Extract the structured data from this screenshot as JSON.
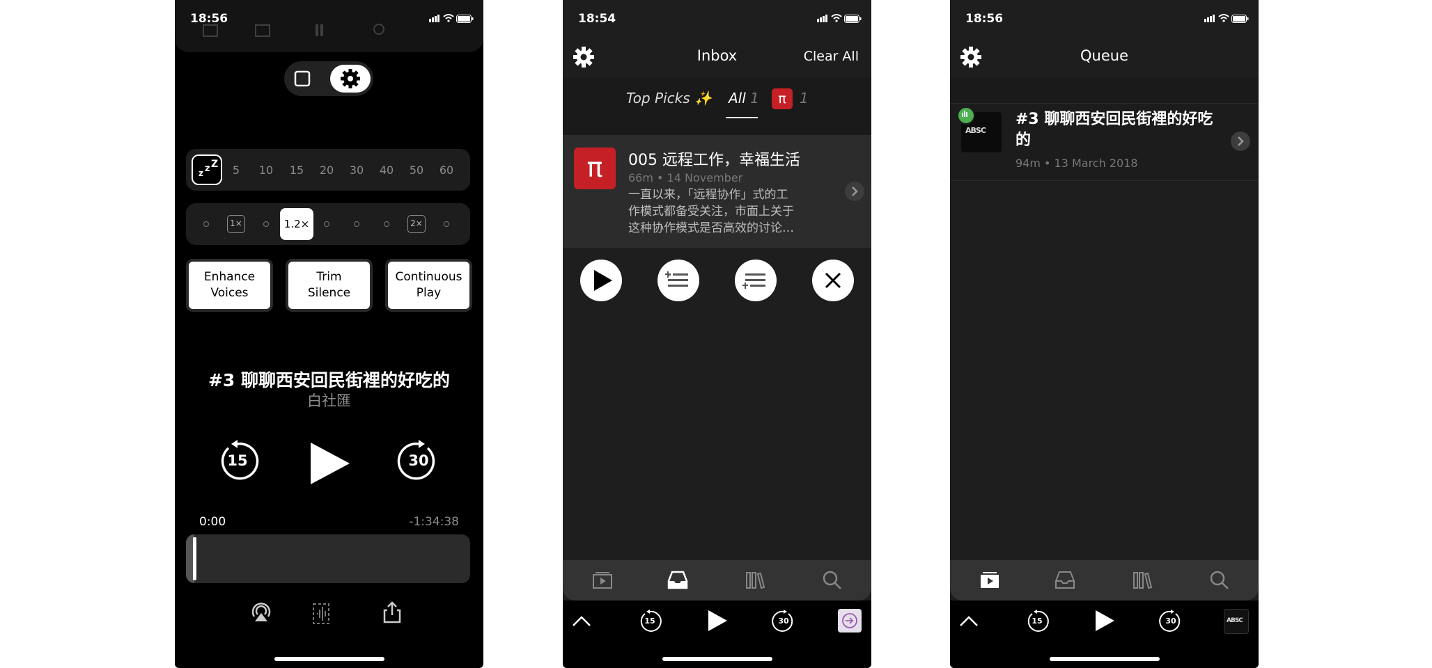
{
  "phone1": {
    "status": {
      "time": "18:56"
    },
    "sleep_timer": {
      "options": [
        "5",
        "10",
        "15",
        "20",
        "30",
        "40",
        "50",
        "60"
      ]
    },
    "speed": {
      "marks": [
        "1×",
        "1.2×",
        "2×"
      ],
      "selected": "1.2×"
    },
    "toggles": [
      {
        "line1": "Enhance",
        "line2": "Voices"
      },
      {
        "line1": "Trim",
        "line2": "Silence"
      },
      {
        "line1": "Continuous",
        "line2": "Play"
      }
    ],
    "episode": {
      "title": "#3 聊聊西安回民街裡的好吃的",
      "artist": "白社匯"
    },
    "skip_back": "15",
    "skip_forward": "30",
    "time_elapsed": "0:00",
    "time_remaining": "-1:34:38",
    "progress": 0
  },
  "phone2": {
    "status": {
      "time": "18:54"
    },
    "header": {
      "title": "Inbox",
      "right": "Clear All"
    },
    "tabs": {
      "top_picks": "Top Picks ✨",
      "all": "All",
      "all_count": "1",
      "pi_icon": "π",
      "pi_count": "1"
    },
    "episode": {
      "art": "π",
      "title": "005 远程工作，幸福生活",
      "meta": "66m • 14 November",
      "desc_lines": [
        "一直以来，「远程协作」式的工",
        "作模式都备受关注，市面上关于",
        "这种协作模式是否高效的讨论…"
      ]
    },
    "mini_player": {
      "skip_back": "15",
      "skip_forward": "30"
    }
  },
  "phone3": {
    "status": {
      "time": "18:56"
    },
    "header": {
      "title": "Queue"
    },
    "episode": {
      "art_text": "ABSC",
      "title": "#3 聊聊西安回民街裡的好吃的",
      "meta": "94m • 13 March 2018"
    },
    "mini_player": {
      "skip_back": "15",
      "skip_forward": "30"
    }
  },
  "colors": {
    "accent_red": "#c42025",
    "badge_green": "#4caf50",
    "dark_bg": "#1e1e1e"
  }
}
